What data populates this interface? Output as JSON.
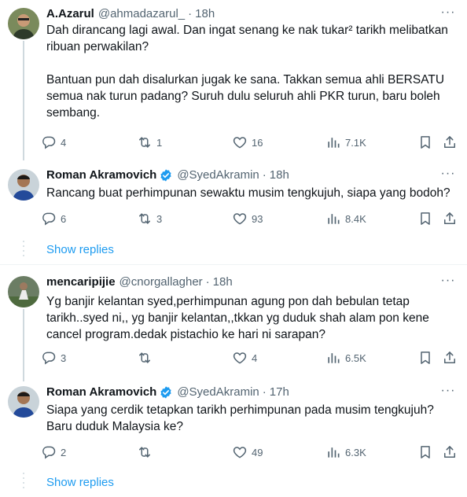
{
  "tweets": [
    {
      "name": "A.Azarul",
      "handle": "@ahmadazarul_",
      "dot": "·",
      "time": "18h",
      "verified": false,
      "text": "Dah dirancang lagi awal. Dan ingat senang ke nak tukar² tarikh melibatkan ribuan perwakilan?\n\nBantuan pun dah disalurkan jugak ke sana. Takkan semua ahli BERSATU semua nak turun padang? Suruh dulu seluruh ahli PKR turun, baru boleh sembang.",
      "replies": "4",
      "reposts": "1",
      "likes": "16",
      "views": "7.1K"
    },
    {
      "name": "Roman Akramovich",
      "handle": "@SyedAkramin",
      "dot": "·",
      "time": "18h",
      "verified": true,
      "text": "Rancang buat perhimpunan sewaktu musim tengkujuh, siapa yang bodoh?",
      "replies": "6",
      "reposts": "3",
      "likes": "93",
      "views": "8.4K"
    },
    {
      "name": "mencaripijie",
      "handle": "@cnorgallagher",
      "dot": "·",
      "time": "18h",
      "verified": false,
      "text": "Yg banjir kelantan syed,perhimpunan agung pon dah bebulan tetap tarikh..syed ni,, yg banjir kelantan,,tkkan yg duduk shah alam pon kene cancel program.dedak pistachio ke hari ni sarapan?",
      "replies": "3",
      "reposts": "",
      "likes": "4",
      "views": "6.5K"
    },
    {
      "name": "Roman Akramovich",
      "handle": "@SyedAkramin",
      "dot": "·",
      "time": "17h",
      "verified": true,
      "text": "Siapa yang cerdik tetapkan tarikh perhimpunan pada musim tengkujuh? Baru duduk Malaysia ke?",
      "replies": "2",
      "reposts": "",
      "likes": "49",
      "views": "6.3K"
    }
  ],
  "show_replies_label": "Show replies",
  "more_label": "···",
  "colors": {
    "text": "#0f1419",
    "secondary": "#536471",
    "link": "#1d9bf0",
    "verified": "#1d9bf0",
    "border": "#eff3f4"
  },
  "icons": [
    "reply-icon",
    "repost-icon",
    "like-icon",
    "views-icon",
    "bookmark-icon",
    "share-icon",
    "more-icon",
    "verified-badge-icon"
  ]
}
